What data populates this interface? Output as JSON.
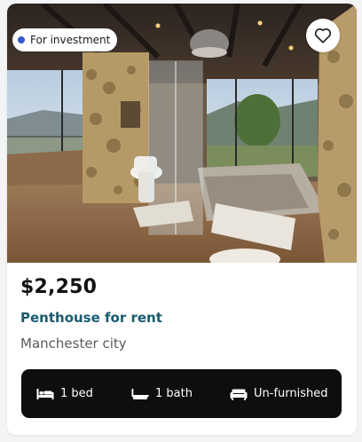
{
  "listing": {
    "badge": "For investment",
    "price": "$2,250",
    "title": "Penthouse for rent",
    "location": "Manchester city",
    "features": {
      "bed": "1 bed",
      "bath": "1 bath",
      "furnishing": "Un-furnished"
    }
  },
  "icons": {
    "favorite": "heart-outline-icon",
    "bed": "bed-icon",
    "bath": "bathtub-icon",
    "furnishing": "sofa-icon"
  },
  "colors": {
    "badge_dot": "#2f5bd3",
    "title": "#1a5b6e",
    "features_bar": "#0e0e0f"
  }
}
